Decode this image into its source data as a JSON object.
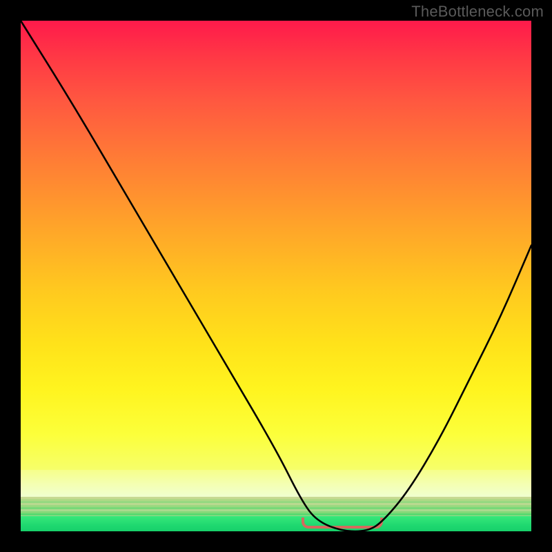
{
  "watermark": "TheBottleneck.com",
  "chart_data": {
    "type": "line",
    "title": "",
    "xlabel": "",
    "ylabel": "",
    "xlim": [
      0,
      100
    ],
    "ylim": [
      0,
      100
    ],
    "optimal_range_x": [
      55,
      71
    ],
    "series": [
      {
        "name": "bottleneck-curve",
        "x": [
          0,
          10,
          20,
          30,
          40,
          50,
          55,
          58,
          63,
          68,
          71,
          76,
          82,
          88,
          94,
          100
        ],
        "y": [
          100,
          84,
          67,
          50,
          33,
          16,
          6,
          2,
          0,
          0,
          2,
          8,
          18,
          30,
          42,
          56
        ]
      }
    ],
    "gradient_stops": [
      {
        "pos": 0,
        "color": "#ff1a4b"
      },
      {
        "pos": 50,
        "color": "#ffc020"
      },
      {
        "pos": 88,
        "color": "#f6ff6a"
      },
      {
        "pos": 97,
        "color": "#1fd870"
      }
    ],
    "bracket_color": "#d46a5e"
  }
}
